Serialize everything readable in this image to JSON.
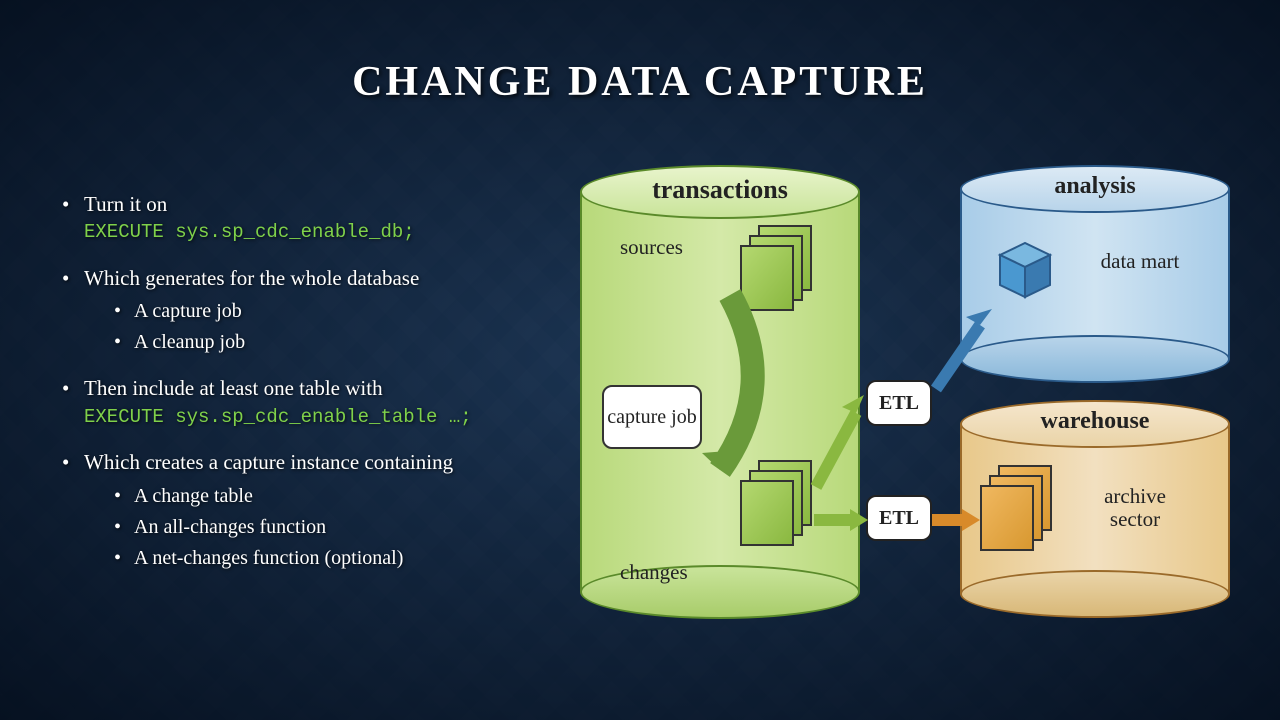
{
  "title": "CHANGE DATA CAPTURE",
  "bullets": {
    "b1": "Turn it on",
    "code1": "EXECUTE sys.sp_cdc_enable_db;",
    "b2": "Which generates for the whole database",
    "b2a": "A capture job",
    "b2b": "A cleanup job",
    "b3": "Then include at least one table with",
    "code3": "EXECUTE sys.sp_cdc_enable_table …;",
    "b4": "Which creates a capture instance containing",
    "b4a": "A change table",
    "b4b": "An all-changes function",
    "b4c": "A net-changes function (optional)"
  },
  "diagram": {
    "transactions": "transactions",
    "sources": "sources",
    "changes": "changes",
    "capture_job": "capture job",
    "etl": "ETL",
    "analysis": "analysis",
    "data_mart": "data mart",
    "warehouse": "warehouse",
    "archive_sector": "archive sector"
  }
}
